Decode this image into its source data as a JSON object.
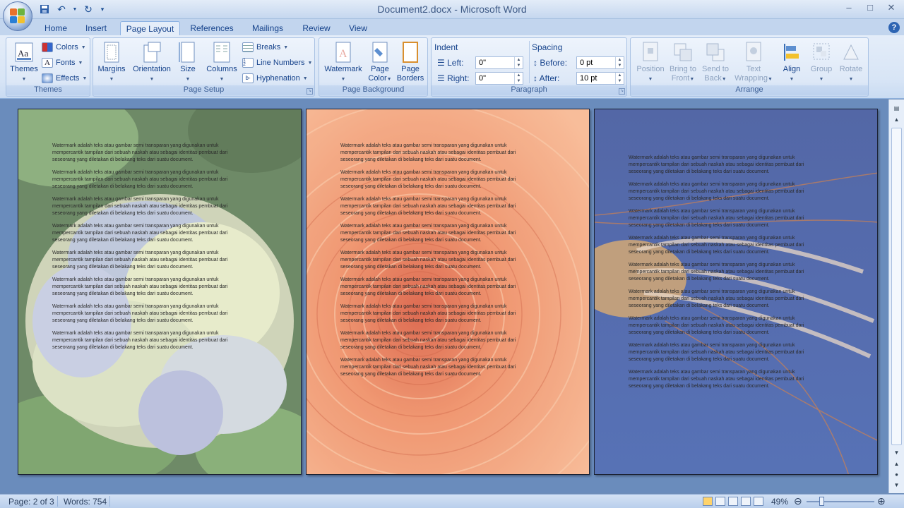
{
  "window": {
    "title": "Document2.docx - Microsoft Word",
    "minimize": "–",
    "maximize": "□",
    "close": "✕"
  },
  "tabs": [
    {
      "label": "Home"
    },
    {
      "label": "Insert"
    },
    {
      "label": "Page Layout",
      "active": true
    },
    {
      "label": "References"
    },
    {
      "label": "Mailings"
    },
    {
      "label": "Review"
    },
    {
      "label": "View"
    }
  ],
  "help": "?",
  "ribbon": {
    "themes": {
      "group": "Themes",
      "themes_label": "Themes",
      "colors": "Colors",
      "fonts": "Fonts",
      "effects": "Effects"
    },
    "page_setup": {
      "group": "Page Setup",
      "margins": "Margins",
      "orientation": "Orientation",
      "size": "Size",
      "columns": "Columns",
      "breaks": "Breaks",
      "line_numbers": "Line Numbers",
      "hyphenation": "Hyphenation"
    },
    "page_background": {
      "group": "Page Background",
      "watermark": "Watermark",
      "page_color_1": "Page",
      "page_color_2": "Color",
      "page_borders_1": "Page",
      "page_borders_2": "Borders"
    },
    "paragraph": {
      "group": "Paragraph",
      "indent": "Indent",
      "left_label": "Left:",
      "left_value": "0\"",
      "right_label": "Right:",
      "right_value": "0\"",
      "spacing": "Spacing",
      "before_label": "Before:",
      "before_value": "0 pt",
      "after_label": "After:",
      "after_value": "10 pt"
    },
    "arrange": {
      "group": "Arrange",
      "position": "Position",
      "bring_to_front_1": "Bring to",
      "bring_to_front_2": "Front",
      "send_to_back_1": "Send to",
      "send_to_back_2": "Back",
      "text_wrapping_1": "Text",
      "text_wrapping_2": "Wrapping",
      "align": "Align",
      "group_btn": "Group",
      "rotate": "Rotate"
    }
  },
  "document": {
    "paragraph_text": "Watermark adalah teks atau gambar semi transparan yang digunakan untuk mempercantik tampilan dari sebuah naskah atau sebagai identitas pembuat dari seseorang yang diletakan di belakang teks dari suatu document.",
    "pages": [
      {
        "background": "hydrangea",
        "paragraphs": 8
      },
      {
        "background": "dahlia",
        "paragraphs": 9
      },
      {
        "background": "jellyfish",
        "paragraphs": 9
      }
    ]
  },
  "status": {
    "page": "Page: 2 of 3",
    "words": "Words: 754",
    "zoom": "49%"
  }
}
